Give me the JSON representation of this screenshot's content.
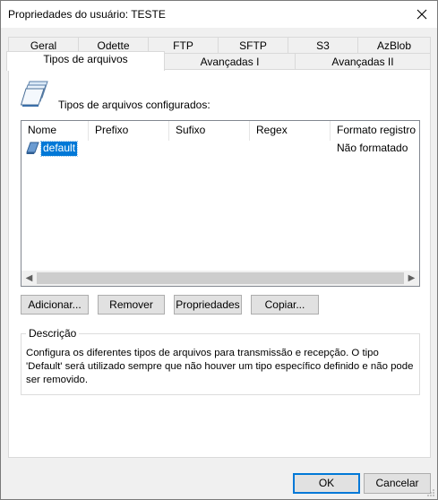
{
  "window": {
    "title": "Propriedades do usuário: TESTE",
    "close_icon": "close-icon"
  },
  "tabs_row1": [
    "Geral",
    "Odette",
    "FTP",
    "SFTP",
    "S3",
    "AzBlob"
  ],
  "tabs_row2": [
    "Tipos de arquivos",
    "Avançadas I",
    "Avançadas II"
  ],
  "active_tab": "Tipos de arquivos",
  "content": {
    "icon": "file-types-icon",
    "configured_label": "Tipos de arquivos configurados:"
  },
  "list": {
    "columns": [
      "Nome",
      "Prefixo",
      "Sufixo",
      "Regex",
      "Formato registro"
    ],
    "rows": [
      {
        "name": "default",
        "prefix": "",
        "suffix": "",
        "regex": "",
        "format": "Não formatado",
        "selected": true
      }
    ]
  },
  "buttons": {
    "add": "Adicionar...",
    "remove": "Remover",
    "properties": "Propriedades",
    "copy": "Copiar..."
  },
  "description": {
    "legend": "Descrição",
    "text": "Configura os diferentes tipos de arquivos para transmissão e recepção. O tipo 'Default' será utilizado sempre que não houver um tipo específico definido e não pode ser removido."
  },
  "footer": {
    "ok": "OK",
    "cancel": "Cancelar"
  },
  "colors": {
    "selection": "#0078d7",
    "button_face": "#e1e1e1",
    "dialog_bg": "#f0f0f0"
  }
}
